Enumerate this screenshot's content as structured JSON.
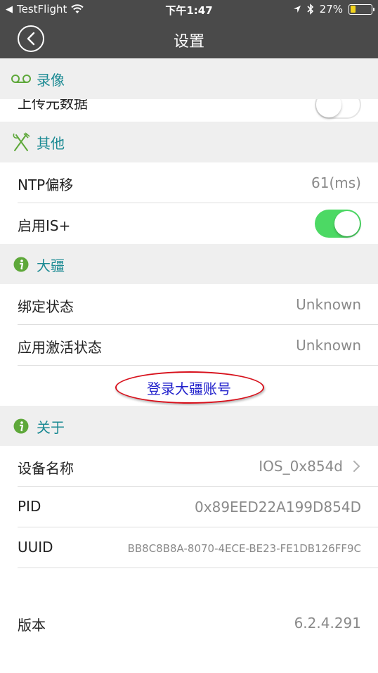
{
  "status_bar": {
    "carrier": "TestFlight",
    "time": "下午1:47",
    "battery_percent": "27%",
    "battery_level": 0.27
  },
  "nav": {
    "title": "设置"
  },
  "sections": {
    "recording": {
      "label": "录像",
      "partial_row_label": "上传元数据"
    },
    "other": {
      "label": "其他"
    },
    "dji": {
      "label": "大疆"
    },
    "about": {
      "label": "关于"
    }
  },
  "rows": {
    "ntp_label": "NTP偏移",
    "ntp_value": "61(ms)",
    "is_label": "启用IS+",
    "bind_label": "绑定状态",
    "bind_value": "Unknown",
    "activate_label": "应用激活状态",
    "activate_value": "Unknown",
    "login_label": "登录大疆账号",
    "device_label": "设备名称",
    "device_value": "IOS_0x854d",
    "pid_label": "PID",
    "pid_value": "0x89EED22A199D854D",
    "uuid_label": "UUID",
    "uuid_value": "BB8C8B8A-8070-4ECE-BE23-FE1DB126FF9C",
    "version_label": "版本",
    "version_value": "6.2.4.291"
  },
  "colors": {
    "accent_teal": "#1b8a93",
    "toggle_on": "#4cd964",
    "link_blue": "#2222cc",
    "annotation_red": "#d8111c"
  }
}
